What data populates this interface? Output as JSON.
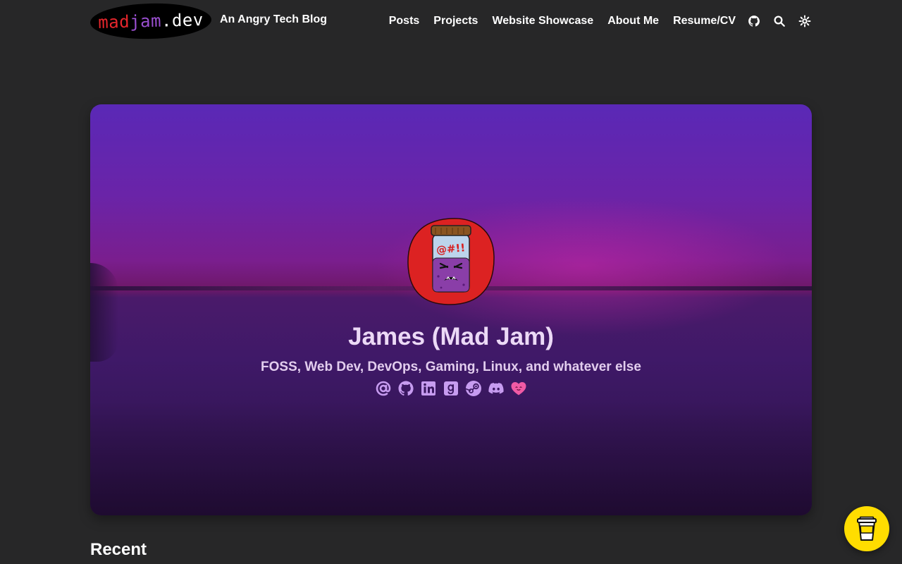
{
  "header": {
    "logo": {
      "part1": "mad",
      "part2": "jam",
      "part3": ".dev"
    },
    "tagline": "An Angry Tech Blog",
    "nav": [
      {
        "label": "Posts"
      },
      {
        "label": "Projects"
      },
      {
        "label": "Website Showcase"
      },
      {
        "label": "About Me"
      },
      {
        "label": "Resume/CV"
      }
    ],
    "icons": [
      "github-icon",
      "search-icon",
      "theme-toggle-icon"
    ]
  },
  "hero": {
    "avatar_icon": "angry-jam-jar-avatar",
    "avatar_text": "@#!!",
    "name": "James (Mad Jam)",
    "subtitle": "FOSS, Web Dev, DevOps, Gaming, Linux, and whatever else",
    "socials": [
      "email-icon",
      "github-icon",
      "linkedin-icon",
      "goodreads-icon",
      "steam-icon",
      "discord-icon",
      "heart-icon"
    ]
  },
  "main": {
    "section_title": "Recent"
  },
  "floating_button": {
    "icon": "coffee-cup-icon"
  },
  "colors": {
    "background": "#272728",
    "accent_red": "#e6262c",
    "accent_purple": "#9a4fd0",
    "social_icon": "#c79cf0",
    "heart": "#f05aa5",
    "coffee_button": "#ffdd00"
  }
}
